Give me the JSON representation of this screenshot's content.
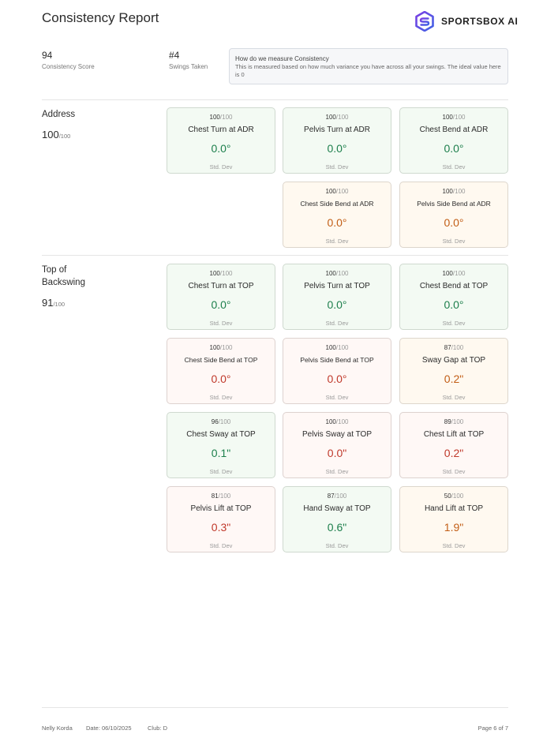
{
  "header": {
    "title": "Consistency Report",
    "logo_text": "SPORTSBOX AI"
  },
  "stats": {
    "score_value": "94",
    "score_label": "Consistency Score",
    "swings_value": "#4",
    "swings_label": "Swings Taken"
  },
  "info": {
    "title": "How do we measure Consistency",
    "body": "This is measured based on how much variance you have across all your swings. The ideal value here is 0"
  },
  "sections": {
    "address": {
      "title": "Address",
      "score": "100",
      "max": "/100",
      "cards": [
        {
          "score": "100",
          "max": "/100",
          "name": "Chest Turn at ADR",
          "value": "0.0°",
          "unit": "Std. Dev"
        },
        {
          "score": "100",
          "max": "/100",
          "name": "Pelvis Turn at ADR",
          "value": "0.0°",
          "unit": "Std. Dev"
        },
        {
          "score": "100",
          "max": "/100",
          "name": "Chest Bend at ADR",
          "value": "0.0°",
          "unit": "Std. Dev"
        },
        {
          "score": "100",
          "max": "/100",
          "name": "Chest Side Bend at ADR",
          "value": "0.0°",
          "unit": "Std. Dev"
        },
        {
          "score": "100",
          "max": "/100",
          "name": "Pelvis Side Bend at ADR",
          "value": "0.0°",
          "unit": "Std. Dev"
        }
      ]
    },
    "top": {
      "title_line1": "Top of",
      "title_line2": "Backswing",
      "score": "91",
      "max": "/100",
      "cards": [
        {
          "score": "100",
          "max": "/100",
          "name": "Chest Turn at TOP",
          "value": "0.0°",
          "unit": "Std. Dev"
        },
        {
          "score": "100",
          "max": "/100",
          "name": "Pelvis Turn at TOP",
          "value": "0.0°",
          "unit": "Std. Dev"
        },
        {
          "score": "100",
          "max": "/100",
          "name": "Chest Bend at TOP",
          "value": "0.0°",
          "unit": "Std. Dev"
        },
        {
          "score": "100",
          "max": "/100",
          "name": "Chest Side Bend at TOP",
          "value": "0.0°",
          "unit": "Std. Dev"
        },
        {
          "score": "100",
          "max": "/100",
          "name": "Pelvis Side Bend at TOP",
          "value": "0.0°",
          "unit": "Std. Dev"
        },
        {
          "score": "87",
          "max": "/100",
          "name": "Sway Gap at TOP",
          "value": "0.2\"",
          "unit": "Std. Dev"
        },
        {
          "score": "96",
          "max": "/100",
          "name": "Chest Sway at TOP",
          "value": "0.1\"",
          "unit": "Std. Dev"
        },
        {
          "score": "100",
          "max": "/100",
          "name": "Pelvis Sway at TOP",
          "value": "0.0\"",
          "unit": "Std. Dev"
        },
        {
          "score": "89",
          "max": "/100",
          "name": "Chest Lift at TOP",
          "value": "0.2\"",
          "unit": "Std. Dev"
        },
        {
          "score": "81",
          "max": "/100",
          "name": "Pelvis Lift at TOP",
          "value": "0.3\"",
          "unit": "Std. Dev"
        },
        {
          "score": "87",
          "max": "/100",
          "name": "Hand Sway at TOP",
          "value": "0.6\"",
          "unit": "Std. Dev"
        },
        {
          "score": "50",
          "max": "/100",
          "name": "Hand Lift at TOP",
          "value": "1.9\"",
          "unit": "Std. Dev"
        }
      ]
    }
  },
  "colors": {
    "good": "#1d7f4c",
    "warning": "#c25e16",
    "poor": "#c0392b",
    "brand_purple": "#7b3fe4",
    "brand_blue": "#3f63e4"
  },
  "footer": {
    "player": "Nelly Korda",
    "date": "Date: 06/10/2025",
    "club": "Club: D",
    "page": "Page 6 of 7"
  }
}
